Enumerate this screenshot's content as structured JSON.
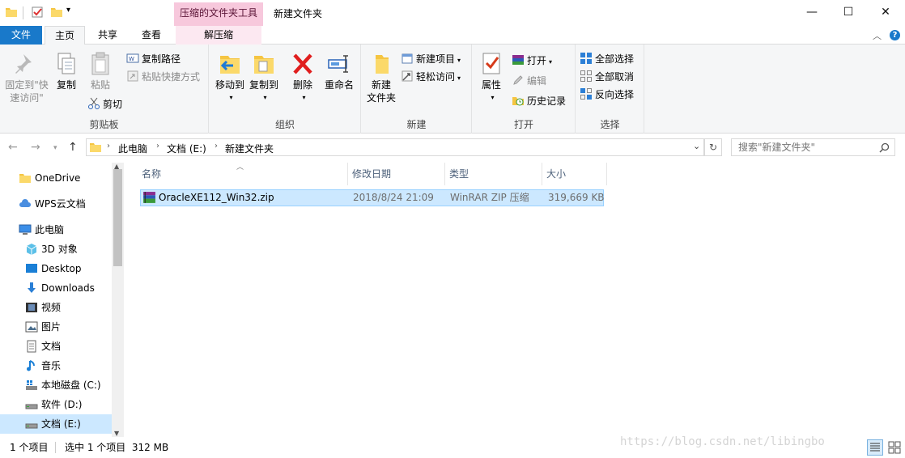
{
  "window": {
    "contextual_tab_header": "压缩的文件夹工具",
    "title": "新建文件夹"
  },
  "tabs": {
    "file": "文件",
    "home": "主页",
    "share": "共享",
    "view": "查看",
    "extract": "解压缩"
  },
  "ribbon": {
    "clipboard": {
      "pin_line1": "固定到\"快",
      "pin_line2": "速访问\"",
      "copy": "复制",
      "paste": "粘贴",
      "copy_path": "复制路径",
      "paste_shortcut": "粘贴快捷方式",
      "cut": "剪切",
      "label": "剪贴板"
    },
    "organize": {
      "move_to": "移动到",
      "copy_to": "复制到",
      "delete": "删除",
      "rename": "重命名",
      "label": "组织"
    },
    "new": {
      "new_folder_line1": "新建",
      "new_folder_line2": "文件夹",
      "new_item": "新建项目",
      "easy_access": "轻松访问",
      "label": "新建"
    },
    "open": {
      "properties": "属性",
      "open": "打开",
      "edit": "编辑",
      "history": "历史记录",
      "label": "打开"
    },
    "select": {
      "select_all": "全部选择",
      "select_none": "全部取消",
      "invert": "反向选择",
      "label": "选择"
    }
  },
  "address": {
    "breadcrumb": [
      "此电脑",
      "文档 (E:)",
      "新建文件夹"
    ],
    "search_placeholder": "搜索\"新建文件夹\""
  },
  "nav_pane": {
    "items": [
      {
        "label": "OneDrive",
        "icon": "folder-icon"
      },
      {
        "label": "WPS云文档",
        "icon": "cloud-icon"
      },
      {
        "label": "此电脑",
        "icon": "computer-icon"
      },
      {
        "label": "3D 对象",
        "icon": "cube-icon"
      },
      {
        "label": "Desktop",
        "icon": "desktop-icon"
      },
      {
        "label": "Downloads",
        "icon": "download-icon"
      },
      {
        "label": "视频",
        "icon": "video-icon"
      },
      {
        "label": "图片",
        "icon": "picture-icon"
      },
      {
        "label": "文档",
        "icon": "document-icon"
      },
      {
        "label": "音乐",
        "icon": "music-icon"
      },
      {
        "label": "本地磁盘 (C:)",
        "icon": "windows-drive-icon"
      },
      {
        "label": "软件 (D:)",
        "icon": "drive-icon"
      },
      {
        "label": "文档 (E:)",
        "icon": "drive-icon"
      }
    ]
  },
  "file_list": {
    "columns": [
      "名称",
      "修改日期",
      "类型",
      "大小"
    ],
    "rows": [
      {
        "name": "OracleXE112_Win32.zip",
        "modified": "2018/8/24 21:09",
        "type": "WinRAR ZIP 压缩",
        "size": "319,669 KB"
      }
    ]
  },
  "status": {
    "item_count": "1 个项目",
    "selected": "选中 1 个项目  312 MB"
  },
  "watermark": "https://blog.csdn.net/libingbo",
  "colors": {
    "accent": "#1979ca",
    "selection": "#cce8ff",
    "contextual_tab": "#f7c8dc"
  }
}
